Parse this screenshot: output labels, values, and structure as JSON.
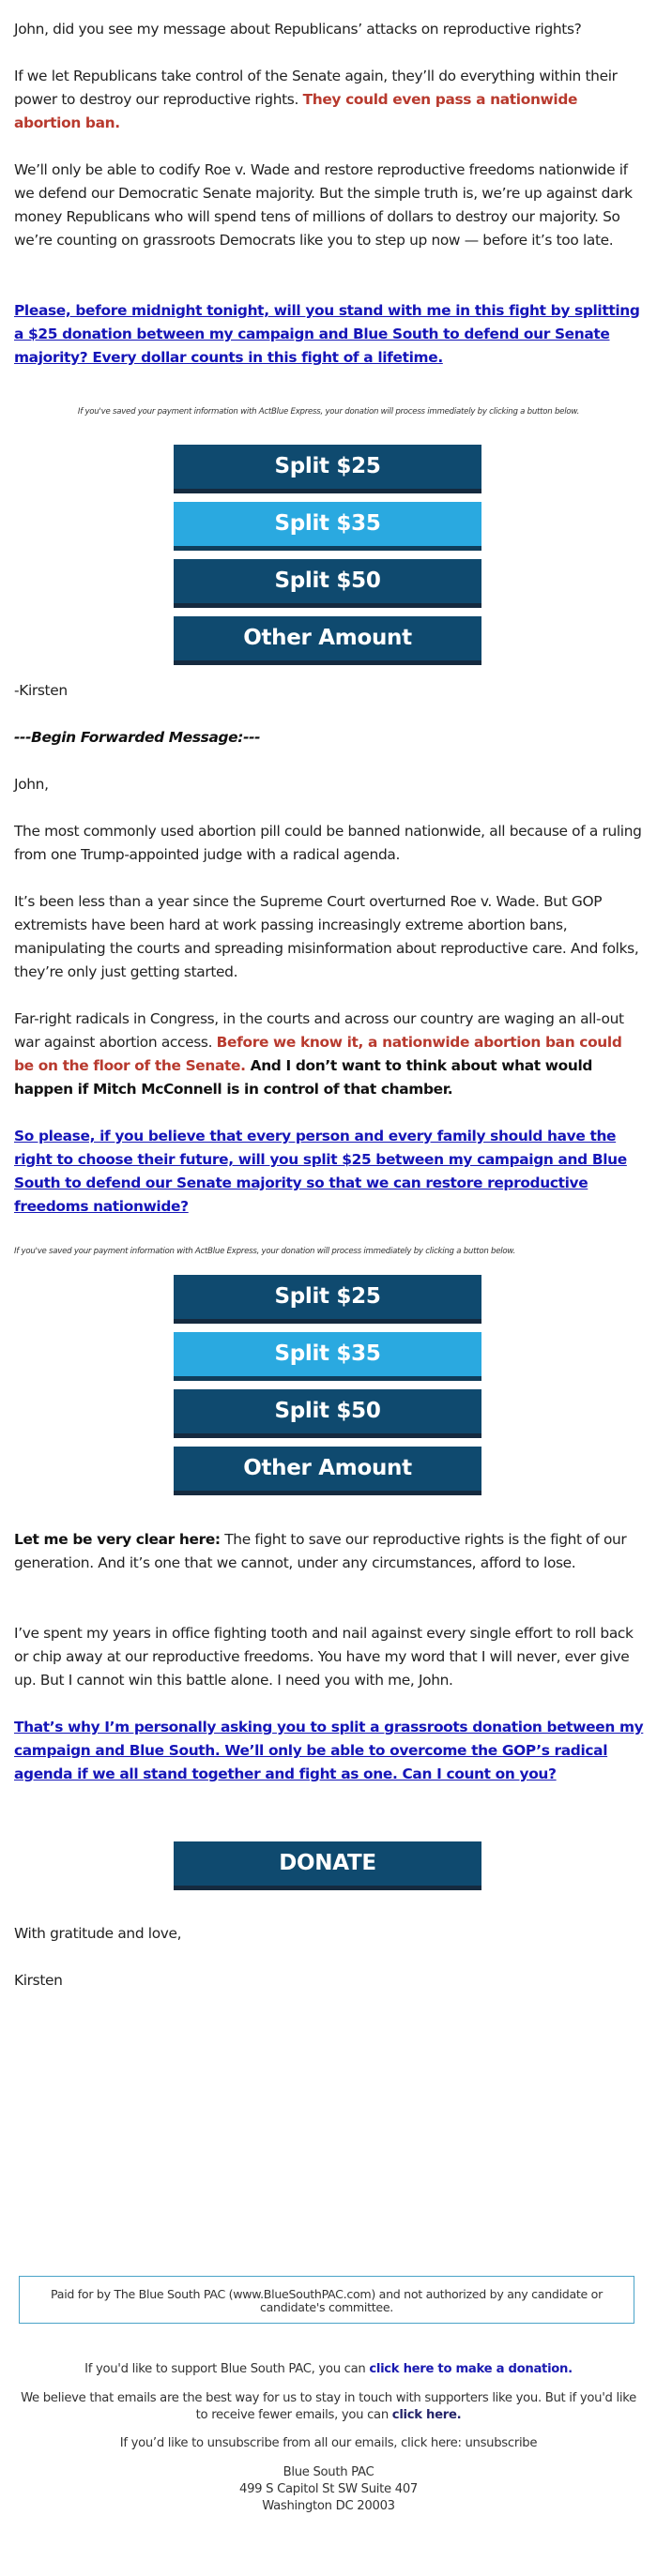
{
  "colors": {
    "button_dark": "#0f4a6f",
    "button_light": "#2aa9e0",
    "button_shadow": "#152a3f",
    "highlight_red": "#b83a2e",
    "link_blue": "#1515b8",
    "disclaimer_border": "#4aa3c8"
  },
  "intro": {
    "p1": "John, did you see my message about Republicans’ attacks on reproductive rights?",
    "p2_text": "If we let Republicans take control of the Senate again, they’ll do everything within their power to destroy our reproductive rights. ",
    "p2_red": "They could even pass a nationwide abortion ban.",
    "p3": "We’ll only be able to codify Roe v. Wade and restore reproductive freedoms nationwide if we defend our Democratic Senate majority. But the simple truth is, we’re up against dark money Republicans who will spend tens of millions of dollars to destroy our majority. So we’re counting on grassroots Democrats like you to step up now — before it’s too late.",
    "cta": "Please, before midnight tonight, will you stand with me in this fight by splitting a $25 donation between my campaign and Blue South to defend our Senate majority? Every dollar counts in this fight of a lifetime."
  },
  "express_note": "If you've saved your payment information with ActBlue Express, your donation will process immediately by clicking a button below.",
  "donation_buttons": [
    {
      "label": "Split $25"
    },
    {
      "label": "Split $35"
    },
    {
      "label": "Split $50"
    },
    {
      "label": "Other Amount"
    }
  ],
  "signoff_short": "-Kirsten",
  "forwarded_heading": "---Begin Forwarded Message:---",
  "forwarded": {
    "greeting": "John,",
    "p1": "The most commonly used abortion pill could be banned nationwide, all because of a ruling from one Trump-appointed judge with a radical agenda.",
    "p2": "It’s been less than a year since the Supreme Court overturned Roe v. Wade. But GOP extremists have been hard at work passing increasingly extreme abortion bans, manipulating the courts and spreading misinformation about reproductive care. And folks, they’re only just getting started.",
    "p3_text": "Far-right radicals in Congress, in the courts and across our country are waging an all-out war against abortion access. ",
    "p3_red": "Before we know it, a nationwide abortion ban could be on the floor of the Senate.",
    "p3_bold": " And I don’t want to think about what would happen if Mitch McConnell is in control of that chamber.",
    "cta": "So please, if you believe that every person and every family should have the right to choose their future, will you split $25 between my campaign and Blue South to defend our Senate majority so that we can restore reproductive freedoms nationwide?",
    "p4_bold": "Let me be very clear here:",
    "p4_text": " The fight to save our reproductive rights is the fight of our generation. And it’s one that we cannot, under any circumstances, afford to lose.",
    "p5": "I’ve spent my years in office fighting tooth and nail against every single effort to roll back or chip away at our reproductive freedoms. You have my word that I will never, ever give up. But I cannot win this battle alone. I need you with me, John.",
    "cta2": "That’s why I’m personally asking you to split a grassroots donation between my campaign and Blue South. We’ll only be able to overcome the GOP’s radical agenda if we all stand together and fight as one. Can I count on you?",
    "donate_label": "DONATE",
    "closing": "With gratitude and love,",
    "signature": "Kirsten"
  },
  "footer": {
    "disclaimer": "Paid for by The Blue South PAC (www.BlueSouthPAC.com) and not authorized by any candidate or candidate's committee.",
    "support_text": "If you'd like to support Blue South PAC, you can ",
    "support_link": "click here to make a donation.",
    "fewer_text": "We believe that emails are the best way for us to stay in touch with supporters like you. But if you'd like to receive fewer emails, you can ",
    "fewer_link": "click here.",
    "unsub_text": "If you’d like to unsubscribe from all our emails, click here: ",
    "unsub_link": "unsubscribe",
    "org_name": "Blue South PAC",
    "address_line1": "499 S Capitol St SW Suite 407",
    "address_line2": "Washington DC 20003"
  }
}
